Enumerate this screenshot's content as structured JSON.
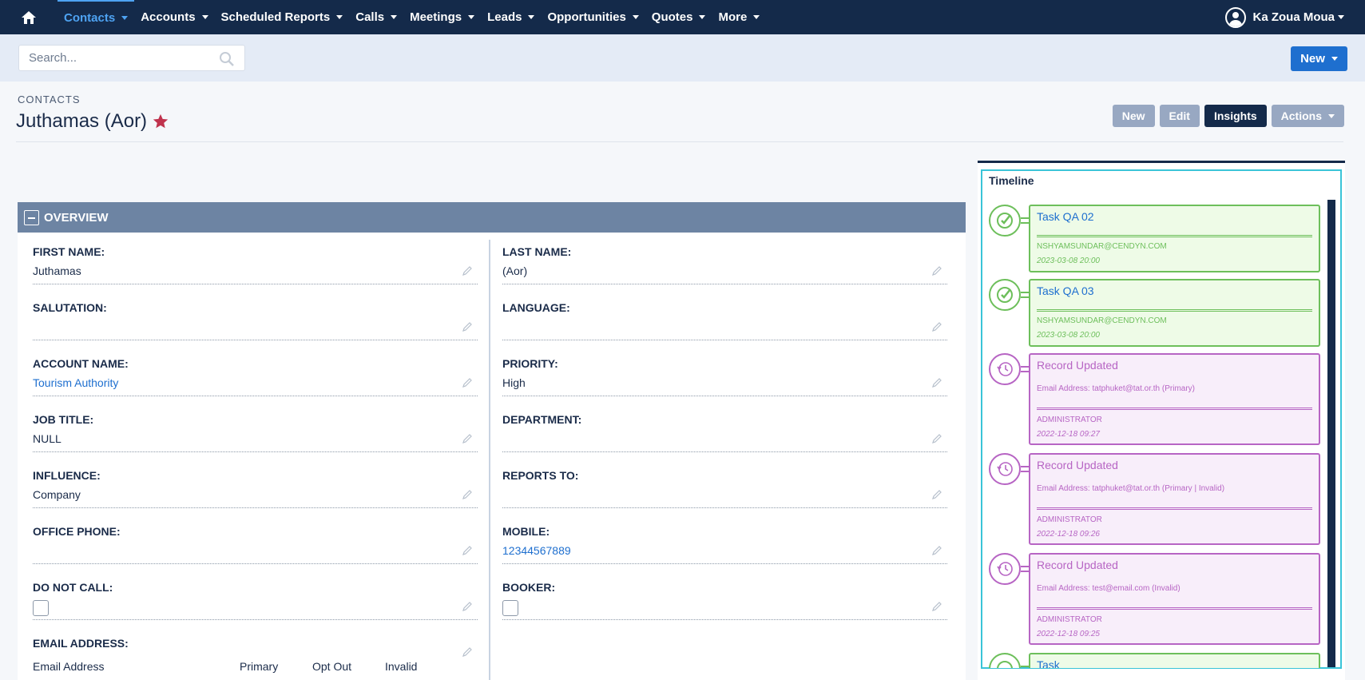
{
  "nav": {
    "items": [
      {
        "label": "Contacts",
        "active": true
      },
      {
        "label": "Accounts",
        "active": false
      },
      {
        "label": "Scheduled Reports",
        "active": false
      },
      {
        "label": "Calls",
        "active": false
      },
      {
        "label": "Meetings",
        "active": false
      },
      {
        "label": "Leads",
        "active": false
      },
      {
        "label": "Opportunities",
        "active": false
      },
      {
        "label": "Quotes",
        "active": false
      },
      {
        "label": "More",
        "active": false
      }
    ],
    "user": "Ka Zoua Moua"
  },
  "search": {
    "placeholder": "Search..."
  },
  "new_button": "New",
  "header": {
    "module": "CONTACTS",
    "title": "Juthamas (Aor)",
    "buttons": {
      "new": "New",
      "edit": "Edit",
      "insights": "Insights",
      "actions": "Actions"
    }
  },
  "overview": {
    "title": "OVERVIEW",
    "first_name": {
      "label": "FIRST NAME:",
      "value": "Juthamas"
    },
    "last_name": {
      "label": "LAST NAME:",
      "value": "(Aor)"
    },
    "salutation": {
      "label": "SALUTATION:",
      "value": ""
    },
    "language": {
      "label": "LANGUAGE:",
      "value": ""
    },
    "account_name": {
      "label": "ACCOUNT NAME:",
      "value": "Tourism Authority"
    },
    "priority": {
      "label": "PRIORITY:",
      "value": "High"
    },
    "job_title": {
      "label": "JOB TITLE:",
      "value": "NULL"
    },
    "department": {
      "label": "DEPARTMENT:",
      "value": ""
    },
    "influence": {
      "label": "INFLUENCE:",
      "value": "Company"
    },
    "reports_to": {
      "label": "REPORTS TO:",
      "value": ""
    },
    "office_phone": {
      "label": "OFFICE PHONE:",
      "value": ""
    },
    "mobile": {
      "label": "MOBILE:",
      "value": "12344567889"
    },
    "do_not_call": {
      "label": "DO NOT CALL:"
    },
    "booker": {
      "label": "BOOKER:"
    },
    "email": {
      "label": "EMAIL ADDRESS:",
      "columns": [
        "Email Address",
        "Primary",
        "Opt Out",
        "Invalid"
      ]
    }
  },
  "timeline": {
    "title": "Timeline",
    "items": [
      {
        "title": "Task QA 02",
        "who": "NSHYAMSUNDAR@CENDYN.COM",
        "when": "2023-03-08 20:00"
      },
      {
        "title": "Task QA 03",
        "who": "NSHYAMSUNDAR@CENDYN.COM",
        "when": "2023-03-08 20:00"
      },
      {
        "title": "Record Updated",
        "detail": "Email Address: tatphuket@tat.or.th (Primary)",
        "who": "ADMINISTRATOR",
        "when": "2022-12-18 09:27"
      },
      {
        "title": "Record Updated",
        "detail": "Email Address: tatphuket@tat.or.th (Primary | Invalid)",
        "who": "ADMINISTRATOR",
        "when": "2022-12-18 09:26"
      },
      {
        "title": "Record Updated",
        "detail": "Email Address: test@email.com (Invalid)",
        "who": "ADMINISTRATOR",
        "when": "2022-12-18 09:25"
      },
      {
        "title": "Task"
      }
    ]
  },
  "colors": {
    "navbar": "#142a4a",
    "accent": "#1e6fcf",
    "task": "#6dbf5b",
    "update": "#b765c4",
    "star": "#c0334d"
  }
}
